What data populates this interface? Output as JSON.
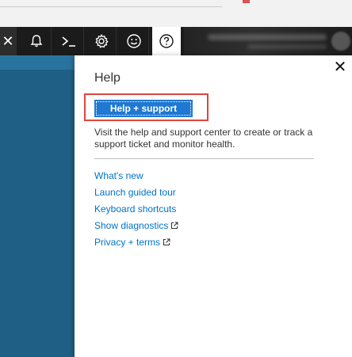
{
  "topbar": {
    "close_glyph": "✕",
    "icons": [
      "close-icon",
      "bell-icon",
      "terminal-icon",
      "gear-icon",
      "smiley-icon",
      "help-icon"
    ],
    "active": "help-icon"
  },
  "help_panel": {
    "title": "Help",
    "close_glyph": "✕",
    "primary_button": "Help + support",
    "description": "Visit the help and support center to create or track a support ticket and monitor health.",
    "links": [
      {
        "label": "What's new",
        "external": false
      },
      {
        "label": "Launch guided tour",
        "external": false
      },
      {
        "label": "Keyboard shortcuts",
        "external": false
      },
      {
        "label": "Show diagnostics",
        "external": true
      },
      {
        "label": "Privacy + terms",
        "external": true
      }
    ]
  },
  "colors": {
    "topbar_bg": "#1b1b1b",
    "left_bg": "#1f5f86",
    "primary": "#1f78d1",
    "link": "#0072c6",
    "highlight": "#e0453c"
  }
}
